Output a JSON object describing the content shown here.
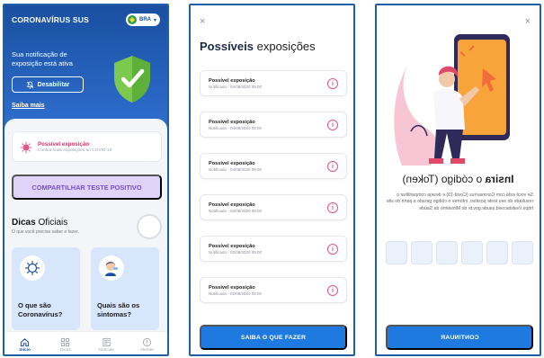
{
  "colors": {
    "brand_blue": "#1a4fa0",
    "accent_blue": "#1f7ae0",
    "alert_pink": "#d6336c",
    "share_purple": "#7a4fd1",
    "shield_green": "#7cc94f"
  },
  "home": {
    "app_title": "CORONAVÍRUS SUS",
    "language": {
      "code": "BRA",
      "icon": "brazil-flag-icon"
    },
    "notification_text": "Sua notificação de exposição está ativa",
    "disable_button": "Desabilitar",
    "learn_more_link": "Saiba mais",
    "exposure_card": {
      "title": "Possível exposição",
      "subtitle": "Confira suas exposições ao COVID-19"
    },
    "share_button": "COMPARTILHAR TESTE POSITIVO",
    "tips": {
      "title_bold": "Dicas",
      "title_rest": " Oficiais",
      "subtitle": "O que você precisa saber e fazer.",
      "cards": [
        {
          "label": "O que são Coronavírus?",
          "icon": "virus-icon"
        },
        {
          "label": "Quais são os sintomas?",
          "icon": "coughing-person-icon"
        }
      ]
    },
    "nav": [
      {
        "label": "Início",
        "icon": "home-icon"
      },
      {
        "label": "Dicas",
        "icon": "grid-icon"
      },
      {
        "label": "Notícias",
        "icon": "newspaper-icon"
      },
      {
        "label": "Alertas",
        "icon": "alert-icon"
      }
    ]
  },
  "exposures": {
    "close_label": "×",
    "title_bold": "Possíveis",
    "title_rest": " exposições",
    "items": [
      {
        "title": "Possível exposição",
        "subtitle": "Notificado - 04/08/2020 09:00"
      },
      {
        "title": "Possível exposição",
        "subtitle": "Notificado - 04/08/2020 09:00"
      },
      {
        "title": "Possível exposição",
        "subtitle": "Notificado - 04/08/2020 09:00"
      },
      {
        "title": "Possível exposição",
        "subtitle": "Notificado - 02/08/2020 09:00"
      },
      {
        "title": "Possível exposição",
        "subtitle": "Notificado - 02/08/2020 09:00"
      },
      {
        "title": "Possível exposição",
        "subtitle": "Notificado - 02/08/2020 09:00"
      }
    ],
    "info_icon_glyph": "i",
    "action_button": "SAIBA O QUE FAZER"
  },
  "token": {
    "close_label": "×",
    "title_bold": "Insira",
    "title_rest": " o código (Token)",
    "description": "Se você está com Coronavírus (Covid-19) e deseja compartilhar o resultado do seu teste positivo, informe o código gerado a partir do site https://validacovid.saude.gov.br do Ministério da Saúde.",
    "code_slots": 6,
    "continue_button": "CONTINUAR"
  }
}
